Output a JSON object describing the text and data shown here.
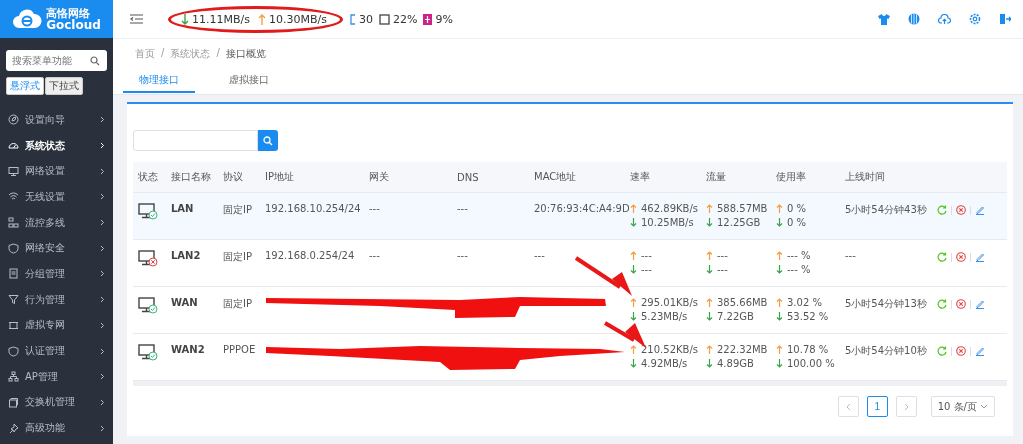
{
  "logo": {
    "title": "高恪网络",
    "subtitle": "Gocloud"
  },
  "sidebar": {
    "search": {
      "placeholder": "搜索菜单功能"
    },
    "modes": [
      {
        "label": "悬浮式",
        "selected": true
      },
      {
        "label": "下拉式",
        "selected": false
      }
    ],
    "items": [
      {
        "label": "设置向导",
        "selected": false
      },
      {
        "label": "系统状态",
        "selected": true
      },
      {
        "label": "网络设置",
        "selected": false
      },
      {
        "label": "无线设置",
        "selected": false
      },
      {
        "label": "流控多线",
        "selected": false
      },
      {
        "label": "网络安全",
        "selected": false
      },
      {
        "label": "分组管理",
        "selected": false
      },
      {
        "label": "行为管理",
        "selected": false
      },
      {
        "label": "虚拟专网",
        "selected": false
      },
      {
        "label": "认证管理",
        "selected": false
      },
      {
        "label": "AP管理",
        "selected": false
      },
      {
        "label": "交换机管理",
        "selected": false
      },
      {
        "label": "高级功能",
        "selected": false
      }
    ]
  },
  "topbar": {
    "download": "11.11MB/s",
    "upload": "10.30MB/s",
    "connections": "30",
    "cpu": "22%",
    "memory": "9%"
  },
  "breadcrumb": [
    {
      "label": "首页"
    },
    {
      "separator": "/",
      "label": "系统状态"
    },
    {
      "separator": "/",
      "label": "接口概览"
    }
  ],
  "tabs": [
    {
      "label": "物理接口",
      "selected": true
    },
    {
      "label": "虚拟接口",
      "selected": false
    }
  ],
  "table": {
    "columns": [
      "状态",
      "接口名称",
      "协议",
      "IP地址",
      "网关",
      "DNS",
      "MAC地址",
      "速率",
      "流量",
      "使用率",
      "上线时间"
    ],
    "rows": [
      {
        "connected": true,
        "highlighted": true,
        "name": "LAN",
        "protocol": "固定IP",
        "ip": "192.168.10.254/24",
        "gateway": "---",
        "dns": "---",
        "mac": "20:76:93:4C:A4:9D",
        "rate": {
          "up": "462.89KB/s",
          "down": "10.25MB/s"
        },
        "traffic": {
          "up": "588.57MB",
          "down": "12.25GB"
        },
        "usage": {
          "up": "0 %",
          "down": "0 %"
        },
        "uptime": "5小时54分钟43秒"
      },
      {
        "connected": false,
        "highlighted": false,
        "name": "LAN2",
        "protocol": "固定IP",
        "ip": "192.168.0.254/24",
        "gateway": "---",
        "dns": "---",
        "mac": "---",
        "rate": {
          "up": "---",
          "down": "---"
        },
        "traffic": {
          "up": "---",
          "down": "---"
        },
        "usage": {
          "up": "--- %",
          "down": "--- %"
        },
        "uptime": "---"
      },
      {
        "connected": true,
        "highlighted": false,
        "name": "WAN",
        "protocol": "固定IP",
        "rate": {
          "up": "295.01KB/s",
          "down": "5.23MB/s"
        },
        "traffic": {
          "up": "385.66MB",
          "down": "7.22GB"
        },
        "usage": {
          "up": "3.02 %",
          "down": "53.52 %"
        },
        "uptime": "5小时54分钟13秒"
      },
      {
        "connected": true,
        "highlighted": false,
        "name": "WAN2",
        "protocol": "PPPOE",
        "rate": {
          "up": "210.52KB/s",
          "down": "4.92MB/s"
        },
        "traffic": {
          "up": "222.32MB",
          "down": "4.89GB"
        },
        "usage": {
          "up": "10.78 %",
          "down": "100.00 %"
        },
        "uptime": "5小时54分钟10秒"
      }
    ]
  },
  "pagination": {
    "pages": [
      {
        "label": "1",
        "selected": true
      }
    ],
    "page_size": "10 条/页"
  }
}
